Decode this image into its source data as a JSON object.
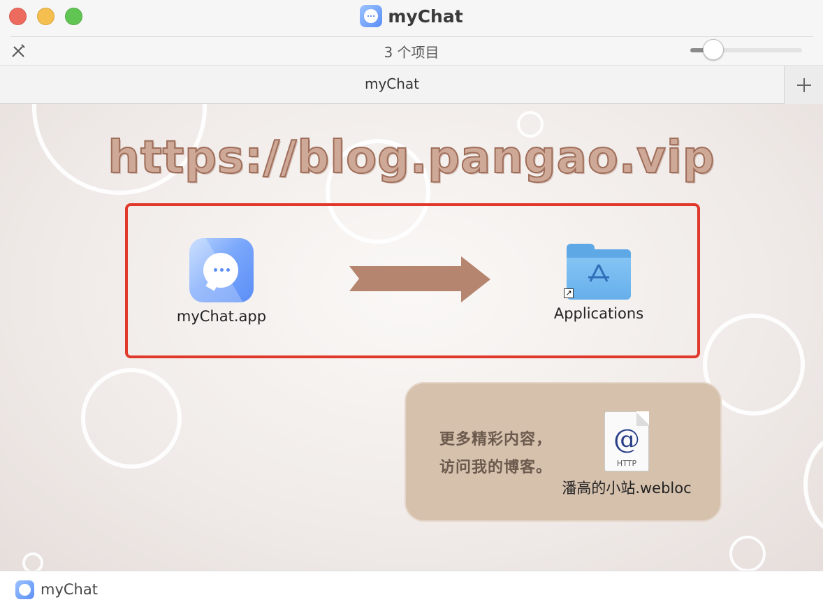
{
  "window": {
    "title": "myChat",
    "title_icon": "mychat-app-icon"
  },
  "toolbar": {
    "item_count": "3 个项目",
    "left_icon": "customize-toolbar-icon"
  },
  "tab": {
    "label": "myChat",
    "add_icon": "plus-icon"
  },
  "content": {
    "watermark": "https://blog.pangao.vip",
    "app_item": {
      "label": "myChat.app",
      "icon": "mychat-app-icon"
    },
    "arrow_icon": "right-arrow-icon",
    "applications_item": {
      "label": "Applications",
      "icon": "applications-folder-icon"
    },
    "promo": {
      "line1": "更多精彩内容，",
      "line2": "访问我的博客。"
    },
    "webloc_item": {
      "label": "潘高的小站.webloc",
      "icon_text": "@",
      "icon_caption": "HTTP"
    }
  },
  "statusbar": {
    "label": "myChat"
  },
  "colors": {
    "highlight_border": "#e0392b",
    "promo_bg": "#d6c1ad",
    "arrow": "#b5856f",
    "accent_blue": "#5b8ef7"
  }
}
